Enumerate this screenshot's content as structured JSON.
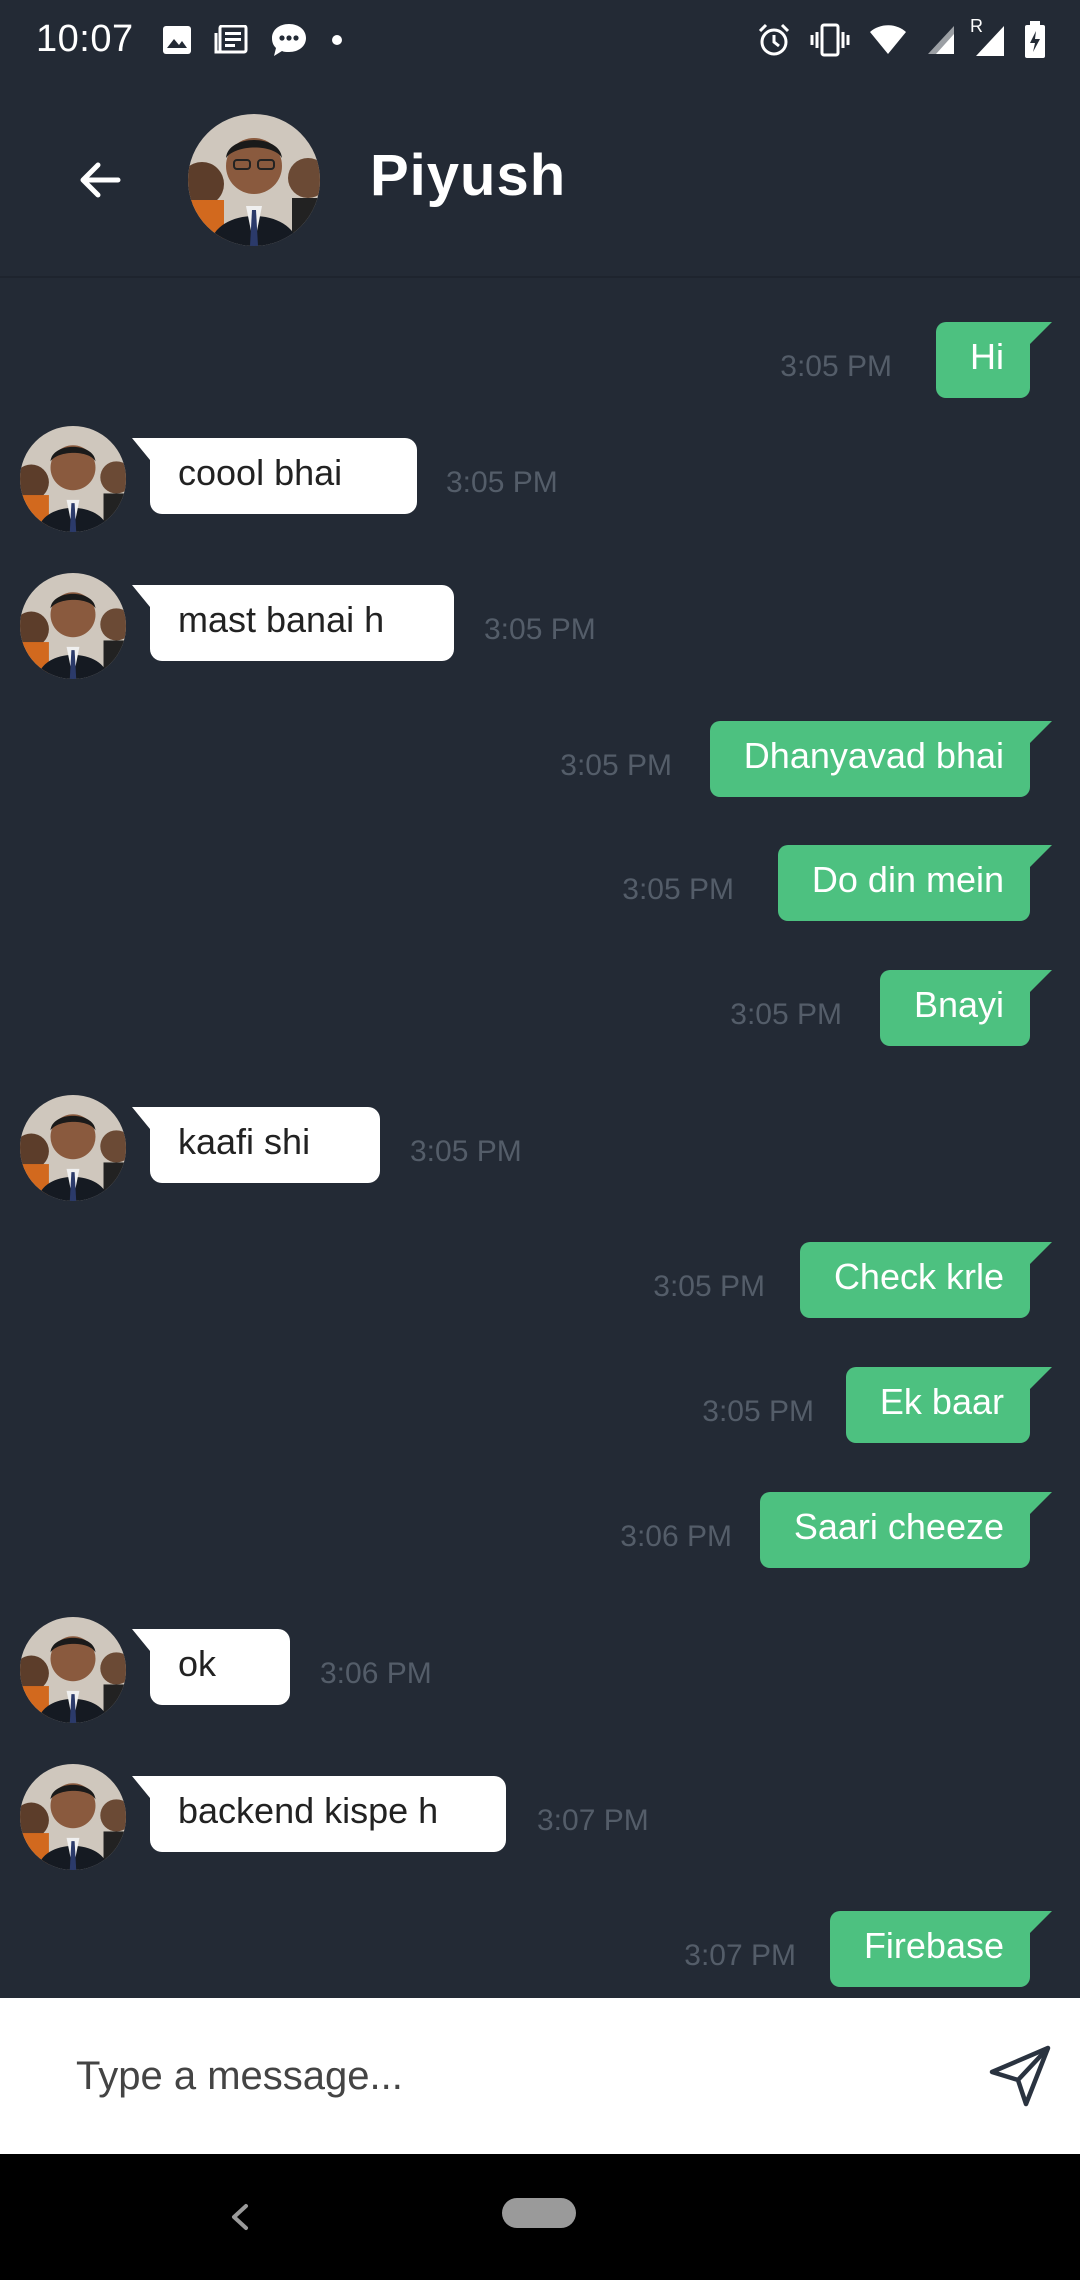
{
  "status_bar": {
    "time": "10:07",
    "left_icons": [
      "image-icon",
      "news-icon",
      "chat-bubble-icon",
      "dot-icon"
    ],
    "right_icons": [
      "alarm-icon",
      "vibrate-icon",
      "wifi-icon",
      "signal-icon",
      "roaming-signal-icon",
      "battery-charging-icon"
    ],
    "roaming_label": "R"
  },
  "header": {
    "contact_name": "Piyush",
    "back_icon": "arrow-left-icon"
  },
  "messages": [
    {
      "side": "sent",
      "text": "Hi",
      "time": "3:05 PM"
    },
    {
      "side": "received",
      "text": "coool bhai",
      "time": "3:05 PM"
    },
    {
      "side": "received",
      "text": "mast banai h",
      "time": "3:05 PM"
    },
    {
      "side": "sent",
      "text": "Dhanyavad bhai",
      "time": "3:05 PM"
    },
    {
      "side": "sent",
      "text": "Do din mein",
      "time": "3:05 PM"
    },
    {
      "side": "sent",
      "text": "Bnayi",
      "time": "3:05 PM"
    },
    {
      "side": "received",
      "text": "kaafi shi",
      "time": "3:05 PM"
    },
    {
      "side": "sent",
      "text": "Check krle",
      "time": "3:05 PM"
    },
    {
      "side": "sent",
      "text": "Ek baar",
      "time": "3:05 PM"
    },
    {
      "side": "sent",
      "text": "Saari cheeze",
      "time": "3:06 PM"
    },
    {
      "side": "received",
      "text": "ok",
      "time": "3:06 PM"
    },
    {
      "side": "received",
      "text": "backend kispe h",
      "time": "3:07 PM"
    },
    {
      "side": "sent",
      "text": "Firebase",
      "time": "3:07 PM"
    }
  ],
  "composer": {
    "placeholder": "Type a message...",
    "value": "",
    "send_icon": "send-icon"
  },
  "nav_bar": {
    "back_icon": "nav-back-icon",
    "home_icon": "home-pill-icon"
  },
  "colors": {
    "background": "#232a35",
    "sent_bubble": "#4dc180",
    "received_bubble": "#ffffff",
    "timestamp": "#545d69"
  }
}
